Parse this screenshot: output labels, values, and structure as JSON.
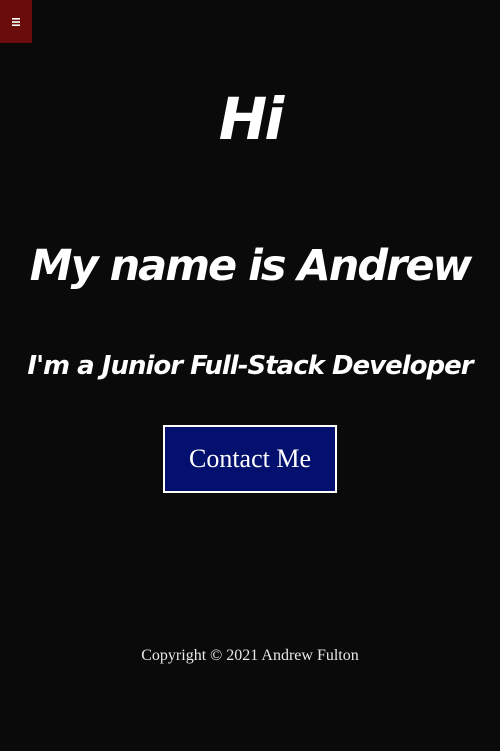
{
  "nav": {
    "menu_icon": "hamburger-menu-icon",
    "menu_color": "#6b0c0c"
  },
  "hero": {
    "greeting": "Hi",
    "name_line": "My name is Andrew",
    "role_line": "I'm a Junior Full-Stack Developer"
  },
  "cta": {
    "label": "Contact Me",
    "background": "#04106d"
  },
  "footer": {
    "copyright": "Copyright © 2021 Andrew Fulton"
  },
  "theme": {
    "background": "#0b0a0b",
    "text": "#ffffff"
  }
}
